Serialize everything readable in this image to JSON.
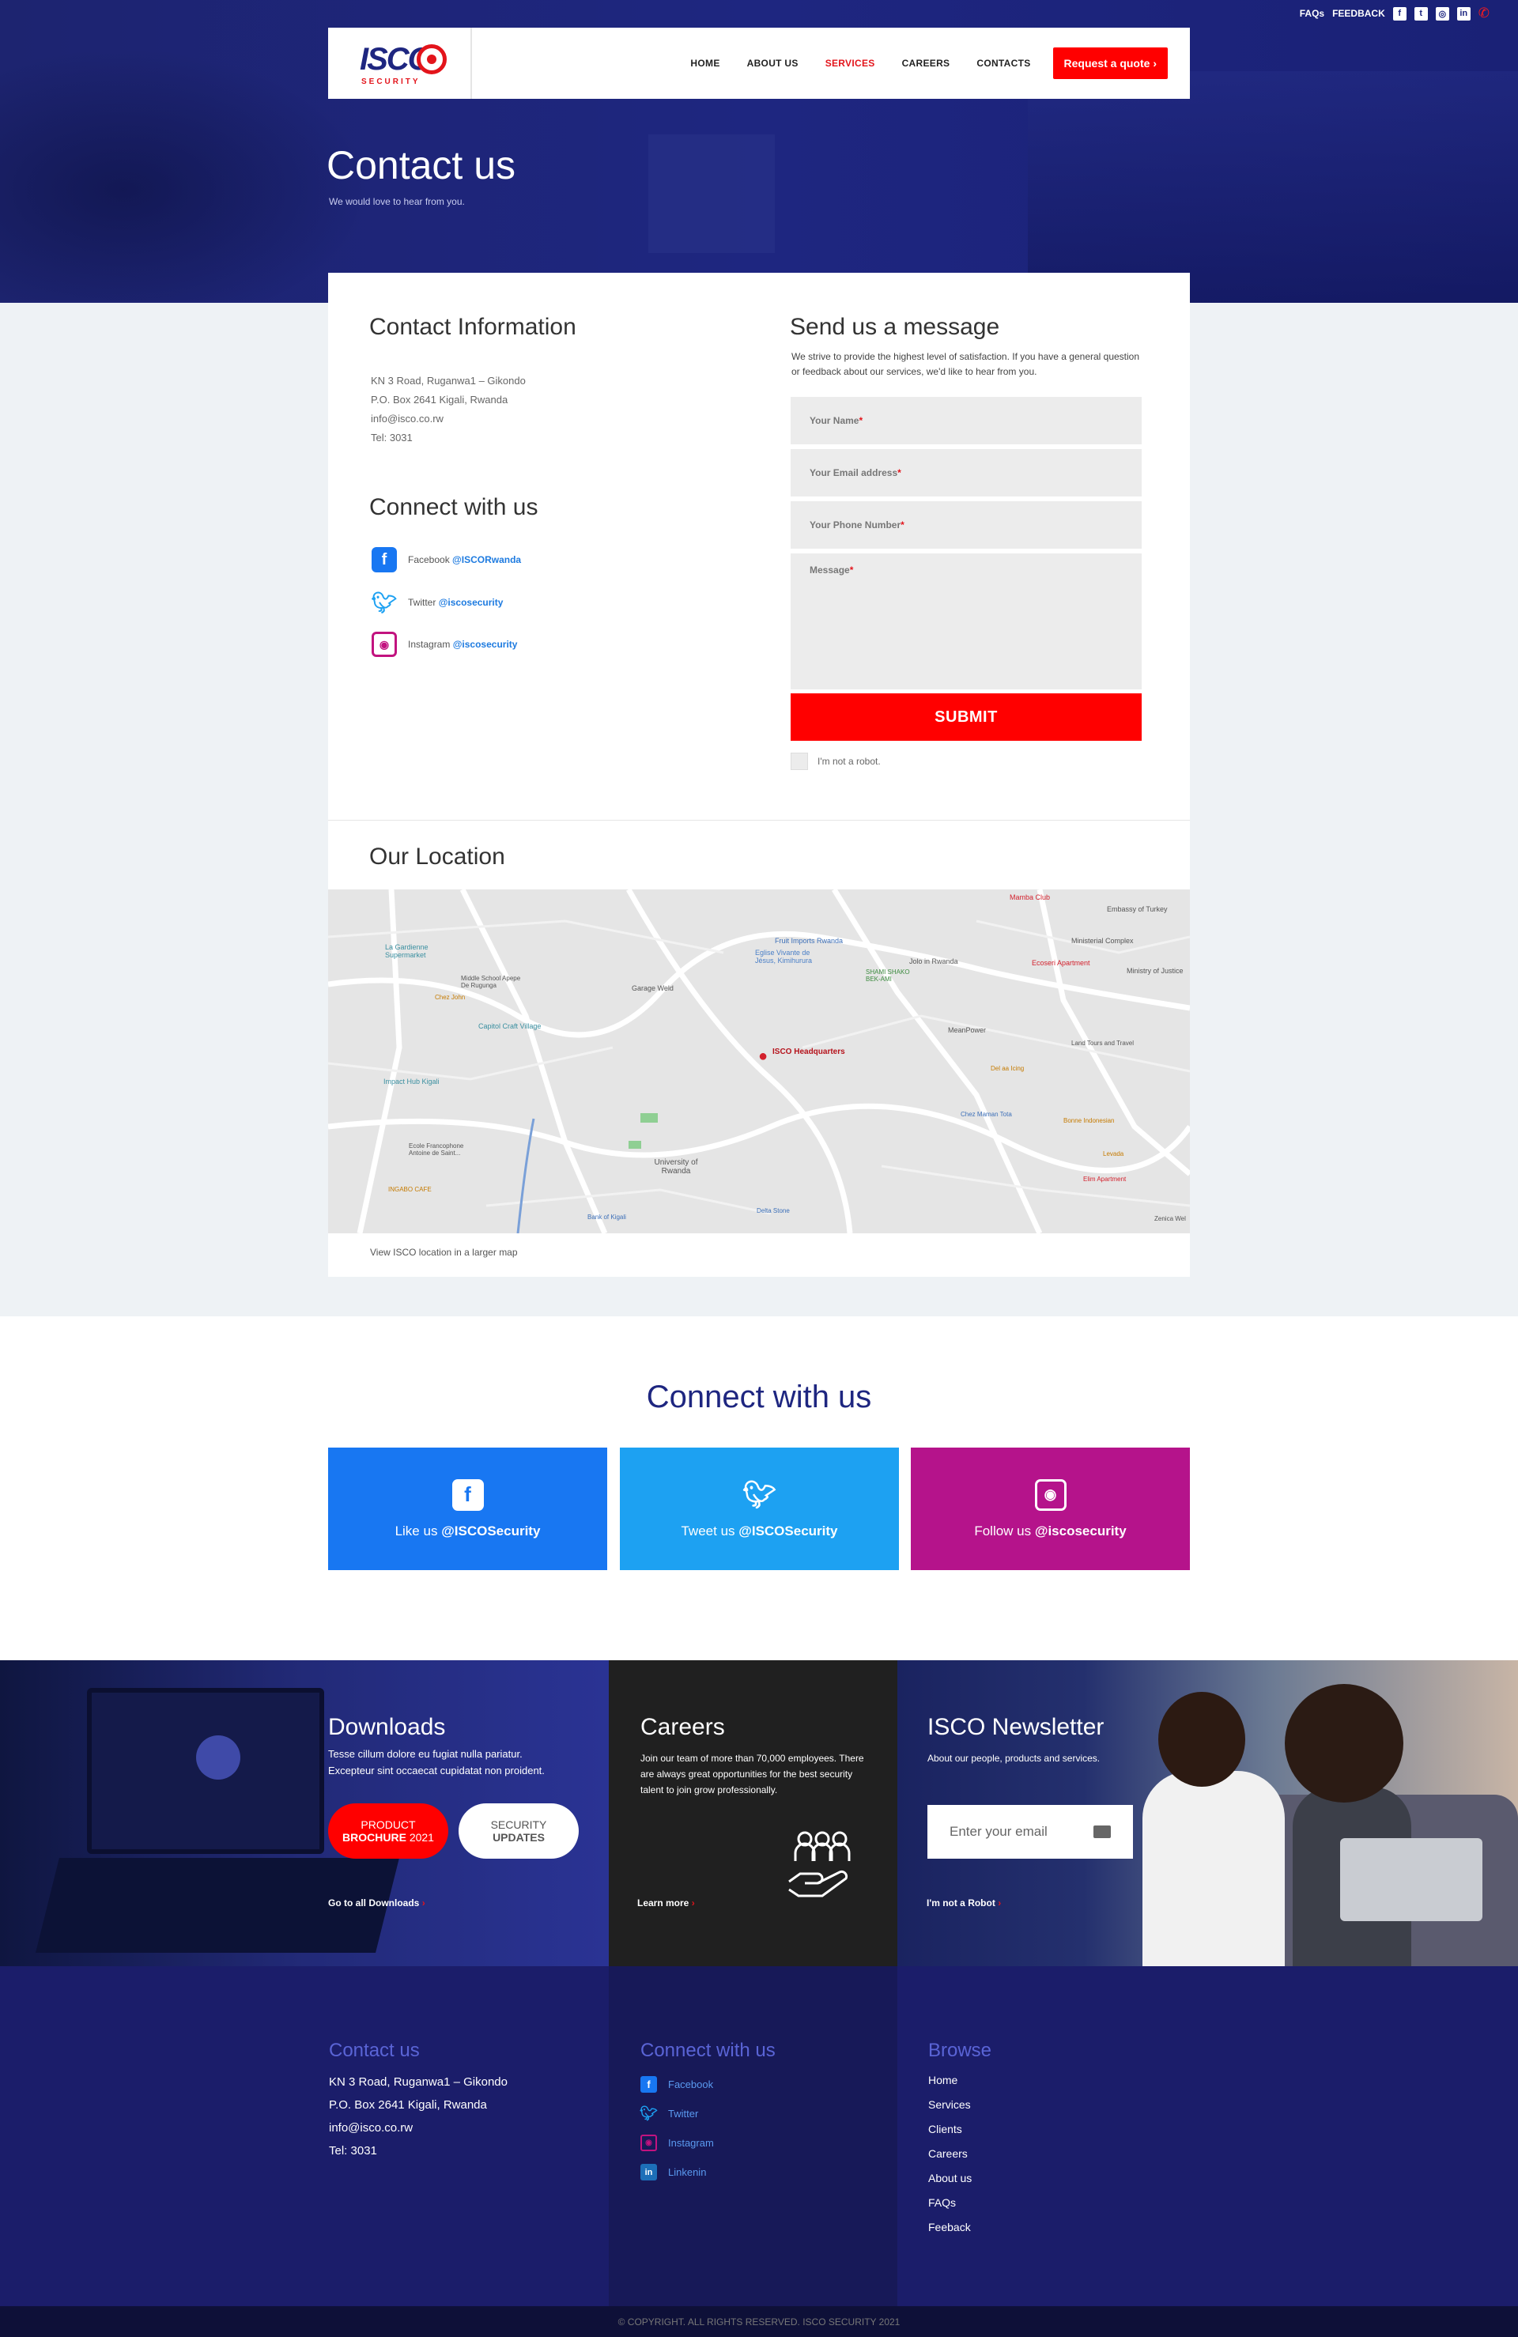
{
  "topbar": {
    "faqs": "FAQs",
    "feedback": "FEEDBACK"
  },
  "brand": {
    "name": "ISCO",
    "tagline": "SECURITY"
  },
  "nav": {
    "items": [
      {
        "label": "HOME"
      },
      {
        "label": "ABOUT US"
      },
      {
        "label": "SERVICES"
      },
      {
        "label": "CAREERS"
      },
      {
        "label": "CONTACTS"
      }
    ],
    "active": "SERVICES",
    "quote": "Request a quote"
  },
  "hero": {
    "title": "Contact us",
    "subtitle": "We would love to hear from you."
  },
  "contact": {
    "title": "Contact Information",
    "address1": "KN 3 Road, Ruganwa1 – Gikondo",
    "address2": "P.O. Box 2641 Kigali, Rwanda",
    "email": "info@isco.co.rw",
    "tel": "Tel: 3031"
  },
  "social": {
    "title": "Connect with us",
    "facebook": {
      "label": "Facebook",
      "handle": "@ISCORwanda"
    },
    "twitter": {
      "label": "Twitter",
      "handle": "@iscosecurity"
    },
    "instagram": {
      "label": "Instagram",
      "handle": "@iscosecurity"
    }
  },
  "form": {
    "title": "Send us a message",
    "intro": "We strive to provide the highest level of satisfaction. If you have a general question or feedback about our services, we'd like to hear from you.",
    "name": "Your Name",
    "email": "Your Email address",
    "phone": "Your Phone Number",
    "message": "Message",
    "required": "*",
    "submit": "SUBMIT",
    "robot": "I'm not a robot."
  },
  "location": {
    "title": "Our Location",
    "link": "View ISCO location in a larger map",
    "labels": [
      "ISCO Headquarters",
      "Eglise Vivante de Jésus, Kimihurura",
      "Fruit Imports Rwanda",
      "Mamba Club",
      "Embassy of Turkey",
      "Ministerial Complex",
      "Ministry of Justice",
      "Ecoseri Apartment",
      "Jolo in Rwanda",
      "SHAMI SHAKO BEK-AMI",
      "Garage Weld",
      "Capitol Craft Village",
      "La Gardienne Supermarket",
      "Middle School Apepe De Rugunga",
      "Chez John",
      "Impact Hub Kigali",
      "Ecole Francophone Antoine de Saint...",
      "INGABO CAFE",
      "University of Rwanda",
      "Bank of Kigali",
      "Delta Stone",
      "MeanPower",
      "Del aa Icing",
      "Chez Maman Tota",
      "Land Tours and Travel",
      "Bonne Indonesian",
      "Levada",
      "Elim Apartment",
      "Zenica Wel"
    ]
  },
  "connect": {
    "title": "Connect with us",
    "facebook": {
      "prefix": "Like us",
      "handle": "@ISCOSecurity",
      "color": "#1877f2"
    },
    "twitter": {
      "prefix": "Tweet us",
      "handle": "@ISCOSecurity",
      "color": "#1da1f2"
    },
    "instagram": {
      "prefix": "Follow us",
      "handle": "@iscosecurity",
      "color": "#b5138b"
    }
  },
  "downloads": {
    "title": "Downloads",
    "text": "Tesse cillum dolore eu fugiat nulla pariatur. Excepteur sint occaecat cupidatat non proident.",
    "btn1_top": "PRODUCT",
    "btn1_bold": "BROCHURE",
    "btn1_year": "2021",
    "btn2_top": "SECURITY",
    "btn2_bold": "UPDATES",
    "link": "Go to all Downloads"
  },
  "careers": {
    "title": "Careers",
    "text": "Join our team of more than 70,000 employees. There are always great opportunities for the best security talent to join grow professionally.",
    "link": "Learn more"
  },
  "newsletter": {
    "title": "ISCO Newsletter",
    "text": "About our people, products and services.",
    "placeholder": "Enter your email",
    "link": "I'm not a Robot"
  },
  "footer": {
    "contact_title": "Contact us",
    "address1": "KN 3 Road, Ruganwa1 – Gikondo",
    "address2": "P.O. Box 2641 Kigali, Rwanda",
    "email": "info@isco.co.rw",
    "tel": "Tel: 3031",
    "connect_title": "Connect with us",
    "social": [
      "Facebook",
      "Twitter",
      "Instagram",
      "Linkenin"
    ],
    "browse_title": "Browse",
    "browse": [
      "Home",
      "Services",
      "Clients",
      "Careers",
      "About us",
      "FAQs",
      "Feeback"
    ],
    "copyright": "© COPYRIGHT. ALL RIGHTS RESERVED. ISCO SECURITY 2021"
  },
  "colors": {
    "navy": "#1e2680",
    "red": "#ff0000",
    "facebook": "#1877f2",
    "twitter": "#1da1f2",
    "instagram": "#b5138b"
  }
}
